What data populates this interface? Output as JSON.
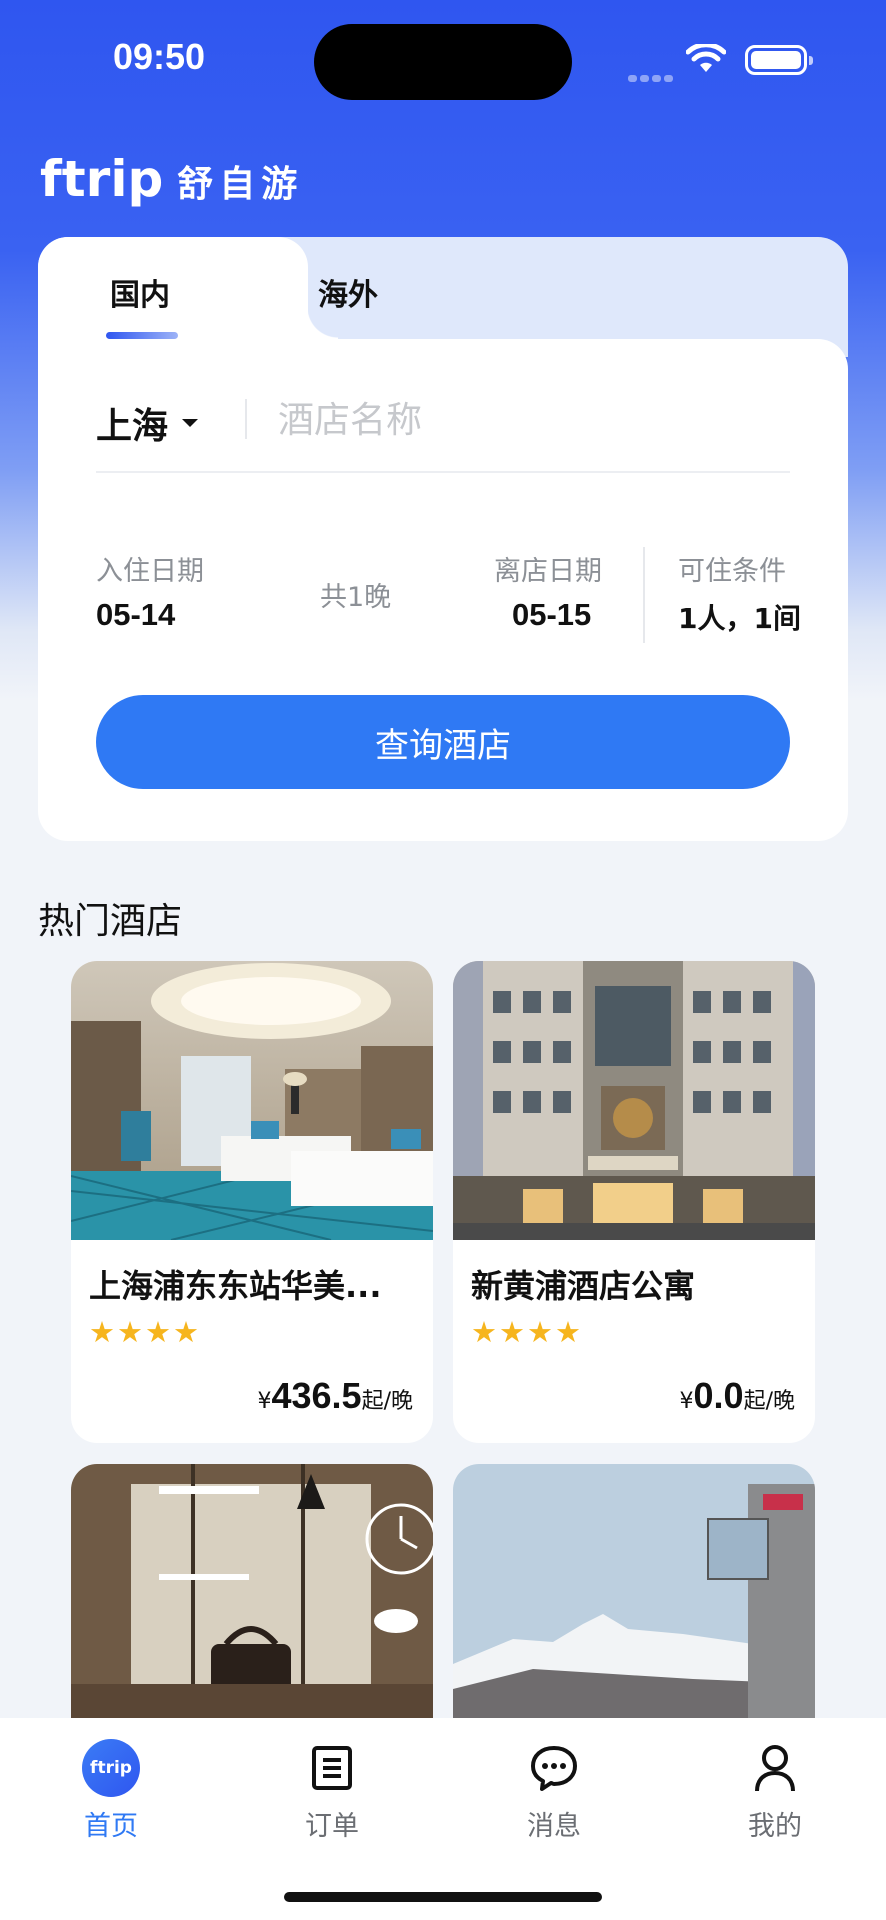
{
  "status_bar": {
    "time": "09:50"
  },
  "brand": {
    "logo": "ftrip",
    "name_cn": "舒自游"
  },
  "search": {
    "tabs": [
      {
        "label": "国内"
      },
      {
        "label": "海外"
      }
    ],
    "city": "上海",
    "hotel_placeholder": "酒店名称",
    "checkin_label": "入住日期",
    "checkin_value": "05-14",
    "nights": "共1晚",
    "checkout_label": "离店日期",
    "checkout_value": "05-15",
    "conditions_label": "可住条件",
    "conditions_value": "1人，1间",
    "button_label": "查询酒店"
  },
  "hot_hotels": {
    "title": "热门酒店",
    "items": [
      {
        "name": "上海浦东东站华美...",
        "stars": 4,
        "currency": "¥",
        "price": "436.5",
        "unit": "起/晚"
      },
      {
        "name": "新黄浦酒店公寓",
        "stars": 4,
        "currency": "¥",
        "price": "0.0",
        "unit": "起/晚"
      },
      {
        "name": "",
        "stars": 0,
        "currency": "",
        "price": "",
        "unit": ""
      },
      {
        "name": "",
        "stars": 0,
        "currency": "",
        "price": "",
        "unit": ""
      }
    ]
  },
  "tab_bar": {
    "items": [
      {
        "label": "首页",
        "icon": "ftrip-home-icon",
        "badge": "ftrip"
      },
      {
        "label": "订单",
        "icon": "order-icon"
      },
      {
        "label": "消息",
        "icon": "message-icon"
      },
      {
        "label": "我的",
        "icon": "user-icon"
      }
    ]
  },
  "colors": {
    "brand_blue": "#2f56f0",
    "button_blue": "#2f79f4",
    "star": "#f6b51e"
  }
}
